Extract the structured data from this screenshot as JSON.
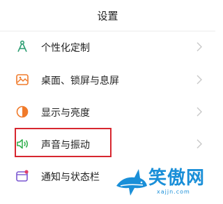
{
  "header": {
    "title": "设置"
  },
  "items": [
    {
      "label": "个性化定制",
      "icon": "compass-icon",
      "color": "#2f9e74"
    },
    {
      "label": "桌面、锁屏与息屏",
      "icon": "wallpaper-icon",
      "color": "#f07a2a"
    },
    {
      "label": "显示与亮度",
      "icon": "brightness-icon",
      "color": "#f07a2a"
    },
    {
      "label": "声音与振动",
      "icon": "speaker-icon",
      "color": "#2fae4b"
    },
    {
      "label": "通知与状态栏",
      "icon": "notification-icon",
      "color": "#7a57d1"
    }
  ],
  "watermark": {
    "text_cn": "笑傲网",
    "text_en": "xajjn.com",
    "color": "#1a8fd8"
  },
  "highlight_color": "#d7262f"
}
